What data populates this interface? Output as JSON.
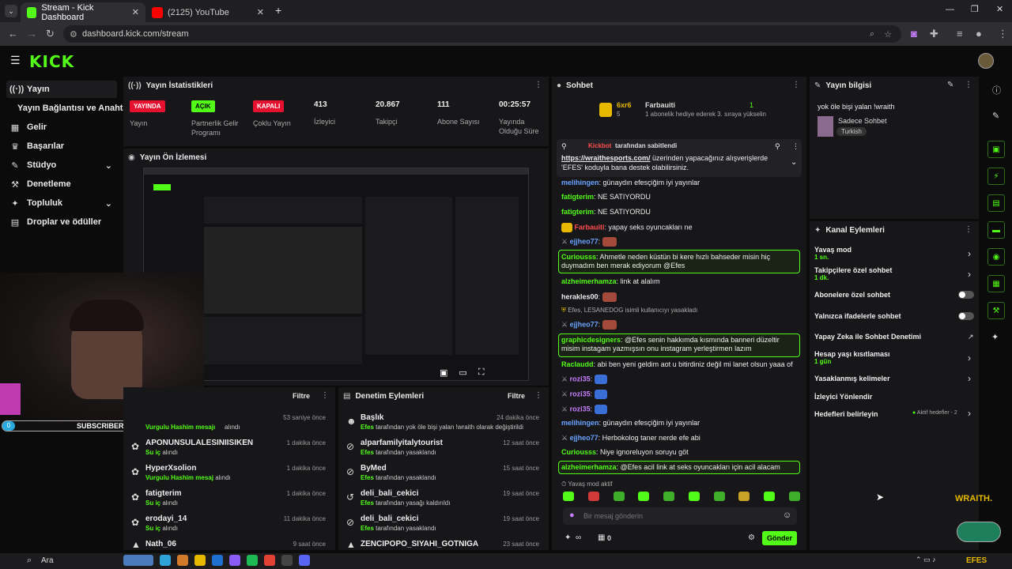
{
  "browser": {
    "tabs": [
      {
        "label": "Stream - Kick Dashboard"
      },
      {
        "label": "(2125) YouTube"
      }
    ],
    "url": "dashboard.kick.com/stream"
  },
  "brand": {
    "logo": "KICK",
    "accent": "#53fc18"
  },
  "sidebar": {
    "items": [
      {
        "label": "Yayın",
        "icon": "broadcast-icon"
      },
      {
        "label": "Yayın Bağlantısı ve Anahtarı",
        "icon": ""
      },
      {
        "label": "Gelir",
        "icon": "money-icon"
      },
      {
        "label": "Başarılar",
        "icon": "trophy-icon"
      },
      {
        "label": "Stüdyo",
        "icon": "studio-icon"
      },
      {
        "label": "Denetleme",
        "icon": "hammer-icon"
      },
      {
        "label": "Topluluk",
        "icon": "community-icon"
      },
      {
        "label": "Droplar ve ödüller",
        "icon": "drops-icon"
      }
    ]
  },
  "stats": {
    "title": "Yayın İstatistikleri",
    "items": [
      {
        "badge": "YAYINDA",
        "label": "Yayın"
      },
      {
        "badge": "AÇIK",
        "label": "Partnerlik Gelir Programı"
      },
      {
        "badge": "KAPALI",
        "label": "Çoklu Yayın"
      },
      {
        "value": "413",
        "label": "İzleyici"
      },
      {
        "value": "20.867",
        "label": "Takipçi"
      },
      {
        "value": "111",
        "label": "Abone Sayısı"
      },
      {
        "value": "00:25:57",
        "label": "Yayında Olduğu Süre"
      }
    ]
  },
  "preview": {
    "title": "Yayın Ön İzlemesi"
  },
  "webcam_overlay": {
    "subs_count": "0",
    "subs_label": "SUBSCRIBERS"
  },
  "activity": {
    "filter": "Filtre",
    "rows": [
      {
        "name": "Vurgulu Hashim mesajı",
        "sub": "alındı",
        "time": "53 saniye önce"
      },
      {
        "name": "APONUNSULALESINIISIKEN",
        "sub_g": "Su iç",
        "sub": "alındı",
        "time": "1 dakika önce"
      },
      {
        "name": "HyperXsolion",
        "sub_g": "Vurgulu Hashim mesaj",
        "sub": "alındı",
        "time": "1 dakika önce"
      },
      {
        "name": "fatigterim",
        "sub_g": "Su iç",
        "sub": "alındı",
        "time": "1 dakika önce"
      },
      {
        "name": "erodayi_14",
        "sub_g": "Su iç",
        "sub": "alındı",
        "time": "11 dakika önce"
      },
      {
        "name": "Nath_06",
        "sub": "",
        "time": "9 saat önce"
      }
    ]
  },
  "moderation": {
    "title": "Denetim Eylemleri",
    "filter": "Filtre",
    "rows": [
      {
        "name": "Başlık",
        "sub_g": "Efes",
        "sub": "tarafından yok öle bişi yalan !wraith olarak değiştirildi",
        "time": "24 dakika önce"
      },
      {
        "name": "alparfamilyitalytourist",
        "sub_g": "Efes",
        "sub": "tarafından yasaklandı",
        "time": "12 saat önce"
      },
      {
        "name": "ByMed",
        "sub_g": "Efes",
        "sub": "tarafından yasaklandı",
        "time": "15 saat önce"
      },
      {
        "name": "deli_bali_cekici",
        "sub_g": "Efes",
        "sub": "tarafından yasağı kaldırıldı",
        "time": "19 saat önce"
      },
      {
        "name": "deli_bali_cekici",
        "sub_g": "Efes",
        "sub": "tarafından yasaklandı",
        "time": "19 saat önce"
      },
      {
        "name": "ZENCIPOPO_SIYAHI_GOTNIGA",
        "sub": "",
        "time": "23 saat önce"
      }
    ]
  },
  "chat": {
    "title": "Sohbet",
    "leader": {
      "name": "6xr6",
      "count": "5",
      "user": "Farbauiti",
      "num": "1",
      "text": "1 abonelik hediye ederek 3. sıraya yükselin"
    },
    "pinned": {
      "by": "Kickbot",
      "by_suffix": "tarafından sabitlendi",
      "link": "https://wraithesports.com/",
      "text": "üzerinden yapacağınız alışverişlerde 'EFES' koduyla bana destek olabilirsiniz."
    },
    "messages": [
      {
        "user": "melihingen",
        "color": "#6aa2ff",
        "text": "günaydın efesçiğim iyi yayınlar"
      },
      {
        "user": "fatigterim",
        "color": "#53fc18",
        "text": "NE SATIYORDU"
      },
      {
        "user": "fatigterim",
        "color": "#53fc18",
        "text": "NE SATIYORDU"
      },
      {
        "user": "Farbauiti",
        "color": "#ff4d4d",
        "text": "yapay seks oyuncakları ne"
      },
      {
        "user": "ejjheo77",
        "color": "#6aa2ff",
        "text": ""
      },
      {
        "user": "Curiousss",
        "color": "#53fc18",
        "text": "Ahmetle neden küstün bi kere hızlı bahseder misin hiç duymadım ben merak ediyorum @Efes"
      },
      {
        "user": "alzheimerhamza",
        "color": "#53fc18",
        "text": "link at alalım"
      },
      {
        "user": "herakles00",
        "color": "#eeeeee",
        "text": ""
      },
      {
        "user": "Efes, LESANEDOG",
        "color": "#aaaaaa",
        "text": "isimli kullanıcıyı yasakladı"
      },
      {
        "user": "ejjheo77",
        "color": "#6aa2ff",
        "text": ""
      },
      {
        "user": "graphicdesigners",
        "color": "#53fc18",
        "text": "@Efes senin hakkımda kısmında banneri düzeltir misim instagam yazmışsın onu instagram yerleştirmen lazım"
      },
      {
        "user": "RacIaudd",
        "color": "#53fc18",
        "text": "abi ben yeni geldim aot u bitirdiniz değil mi lanet olsun yaaa of"
      },
      {
        "user": "rozi35",
        "color": "#c77dff",
        "text": ""
      },
      {
        "user": "rozi35",
        "color": "#c77dff",
        "text": ""
      },
      {
        "user": "rozi35",
        "color": "#c77dff",
        "text": ""
      },
      {
        "user": "melihingen",
        "color": "#6aa2ff",
        "text": "günaydın efesçiğim iyi yayınlar"
      },
      {
        "user": "ejjheo77",
        "color": "#6aa2ff",
        "text": "Herbokolog taner nerde efe abi"
      },
      {
        "user": "Curiousss",
        "color": "#53fc18",
        "text": "Niye ignoreluyon soruyu göt"
      },
      {
        "user": "alzheimerhamza",
        "color": "#53fc18",
        "text": "@Efes acil link at seks oyuncakları için acil alacam"
      }
    ],
    "slow_mode": "Yavaş mod aktif",
    "input_placeholder": "Bir mesaj gönderin",
    "loop_icon": "∞",
    "store_count": "0",
    "send": "Gönder"
  },
  "stream_info": {
    "title": "Yayın bilgisi",
    "stream_title": "yok öle bişi yalan !wraith",
    "category": "Sadece Sohbet",
    "tag": "Turkish"
  },
  "channel_actions": {
    "title": "Kanal Eylemleri",
    "items": [
      {
        "label": "Yavaş mod",
        "sub": "1 sn.",
        "control": "chevron"
      },
      {
        "label": "Takipçilere özel sohbet",
        "sub": "1 dk.",
        "control": "chevron"
      },
      {
        "label": "Abonelere özel sohbet",
        "sub": "",
        "control": "toggle"
      },
      {
        "label": "Yalnızca ifadelerle sohbet",
        "sub": "",
        "control": "toggle"
      },
      {
        "label": "Yapay Zeka ile Sohbet Denetimi",
        "sub": "",
        "control": "external"
      },
      {
        "label": "Hesap yaşı kısıtlaması",
        "sub": "1 gün",
        "control": "chevron"
      },
      {
        "label": "Yasaklanmış kelimeler",
        "sub": "",
        "control": "chevron"
      },
      {
        "label": "İzleyici Yönlendir",
        "sub": "",
        "control": "none"
      },
      {
        "label": "Hedefleri belirleyin",
        "sub": "",
        "control": "chevron",
        "extra": "Aktif hedefler - 2"
      }
    ]
  },
  "overlay_brand": "WRAITH.",
  "taskbar": {
    "search": "Ara",
    "streamer": "EFES"
  }
}
